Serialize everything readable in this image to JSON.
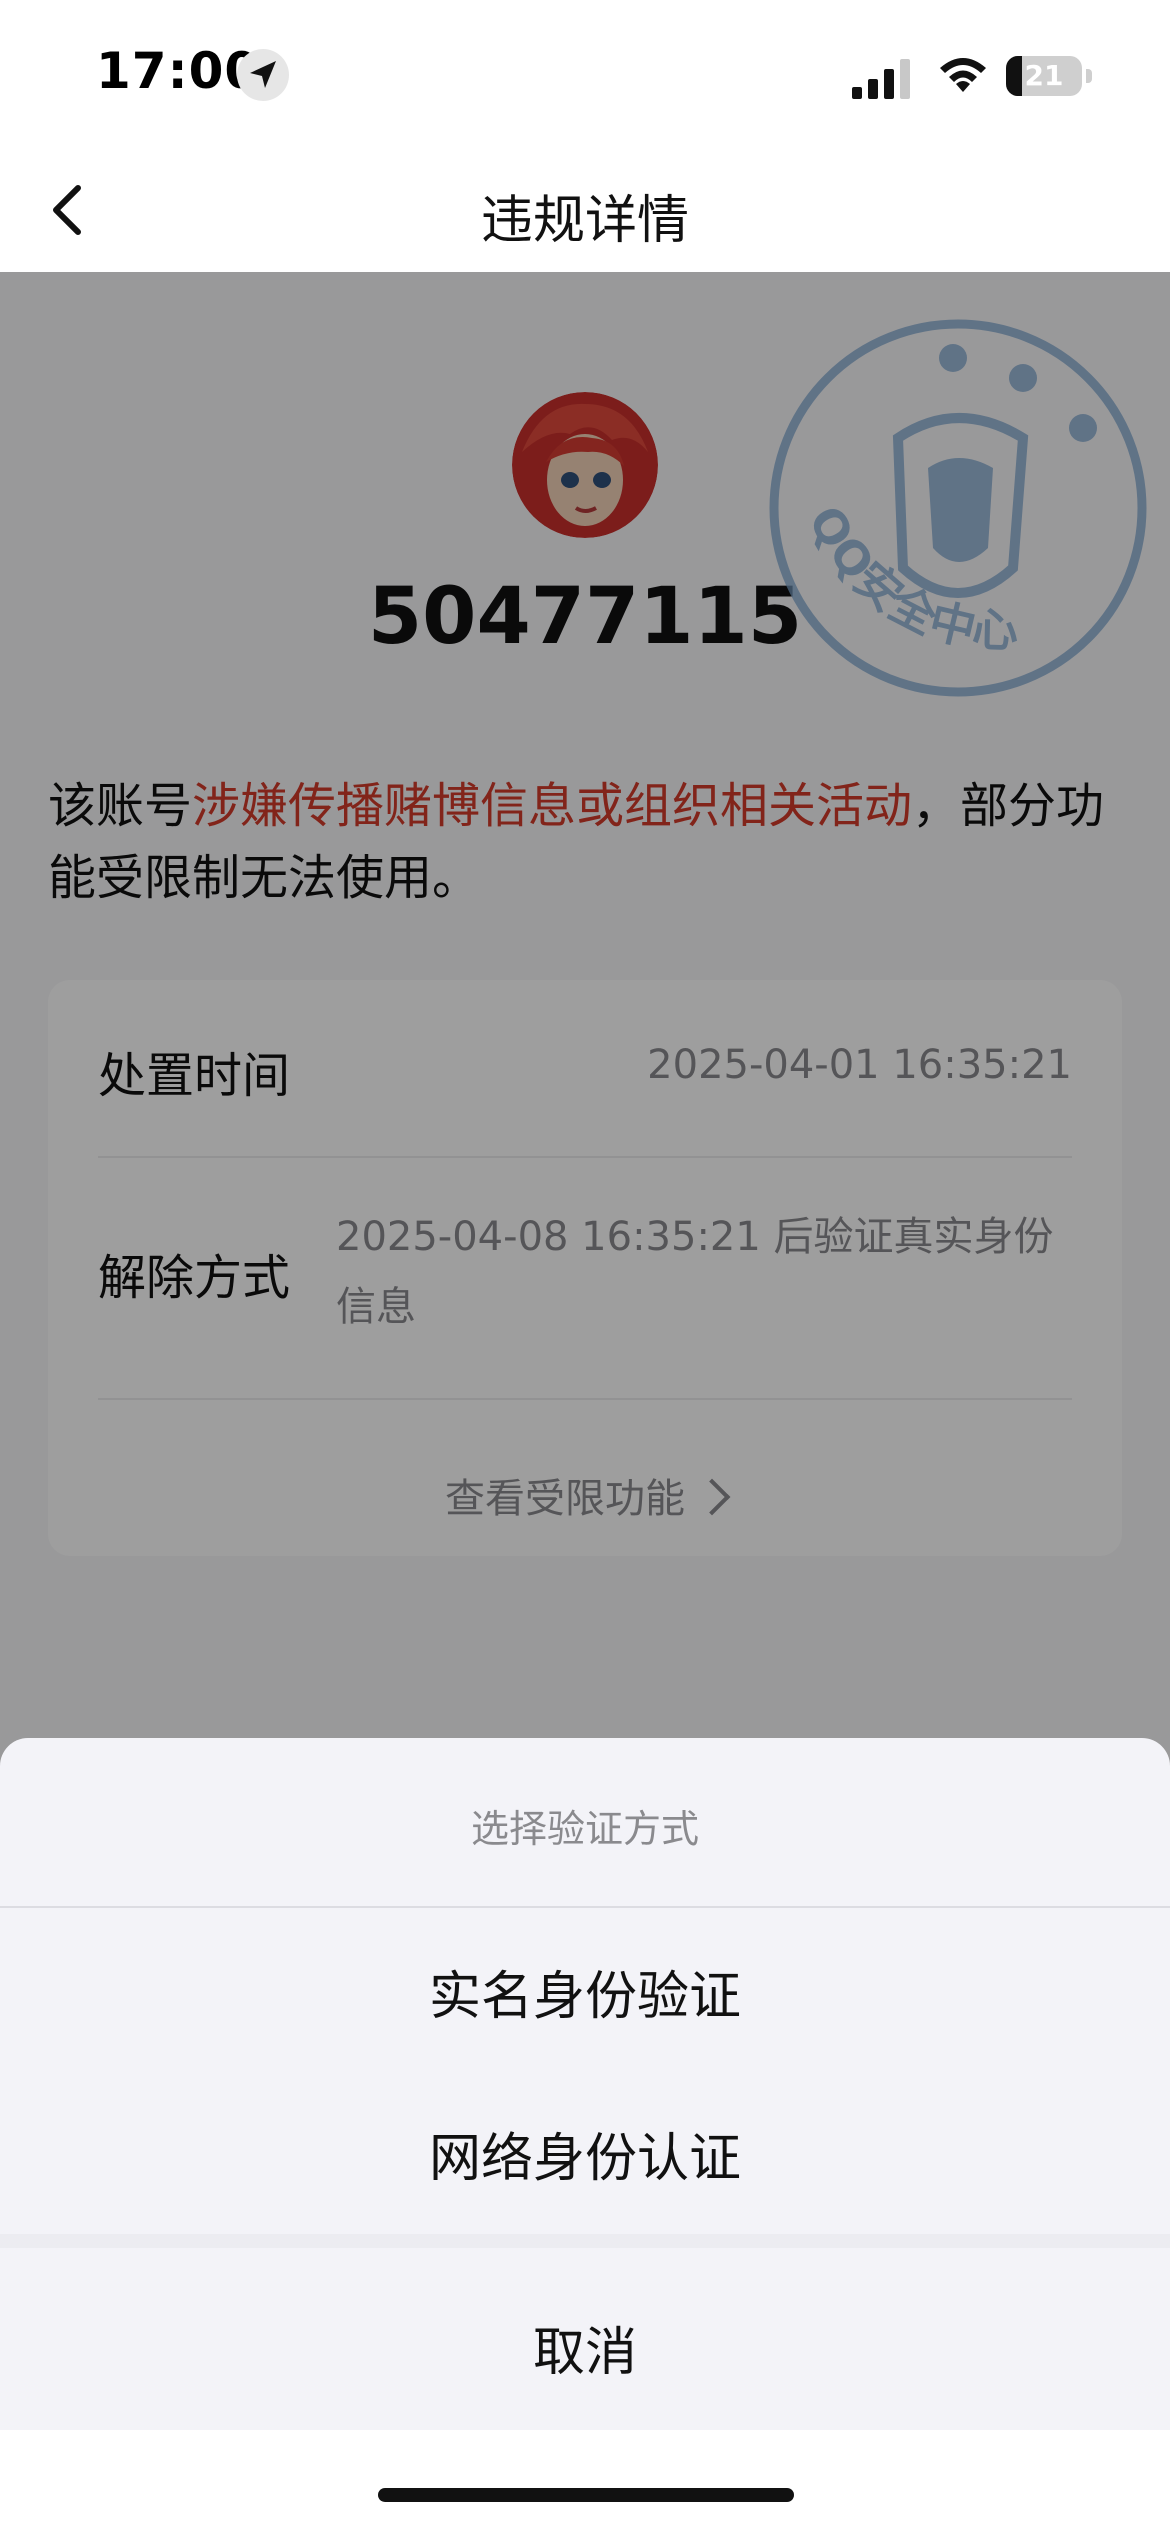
{
  "status_bar": {
    "time": "17:00",
    "battery_level": "21",
    "battery_fraction": 0.21,
    "icons": [
      "location-icon",
      "signal-icon",
      "wifi-icon",
      "battery-icon"
    ]
  },
  "nav": {
    "title": "违规详情",
    "back_icon": "chevron-left-icon"
  },
  "account": {
    "id": "50477115",
    "stamp_text": "QQ安全中心"
  },
  "notice": {
    "prefix": "该账号",
    "violation": "涉嫌传播赌博信息或组织相关活动",
    "suffix": "，部分功能受限制无法使用。"
  },
  "details": {
    "rows": [
      {
        "label": "处置时间",
        "value": "2025-04-01 16:35:21"
      },
      {
        "label": "解除方式",
        "value": "2025-04-08 16:35:21 后验证真实身份信息"
      }
    ],
    "link_label": "查看受限功能"
  },
  "action_sheet": {
    "title": "选择验证方式",
    "options": [
      "实名身份验证",
      "网络身份认证"
    ],
    "cancel_label": "取消"
  },
  "colors": {
    "violation_red": "#d23a2a",
    "stamp_blue": "#7ea6cf",
    "background": "#f7f7f9"
  }
}
